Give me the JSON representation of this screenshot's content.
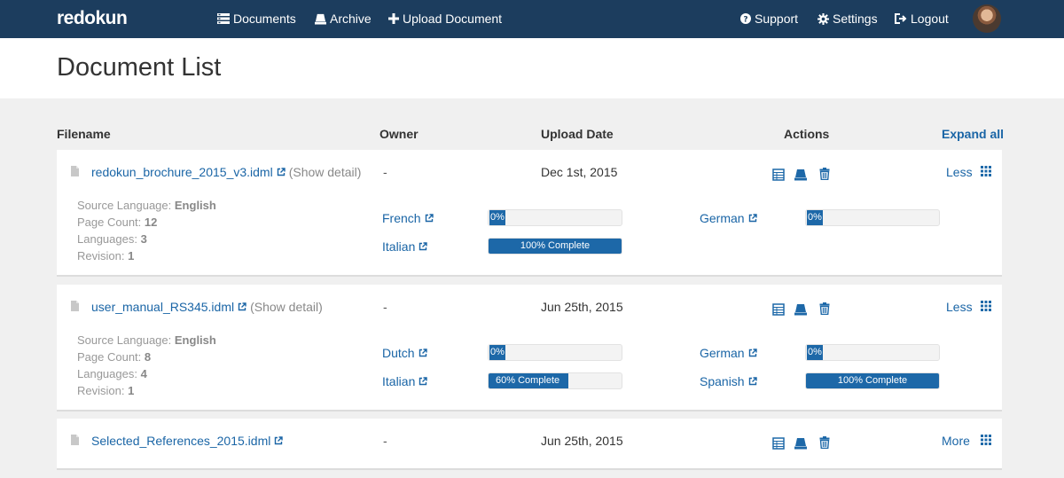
{
  "navbar": {
    "brand": "redokun",
    "documents": "Documents",
    "archive": "Archive",
    "upload": "Upload Document",
    "support": "Support",
    "settings": "Settings",
    "logout": "Logout"
  },
  "page": {
    "title": "Document List"
  },
  "table": {
    "headers": {
      "filename": "Filename",
      "owner": "Owner",
      "upload_date": "Upload Date",
      "actions": "Actions"
    },
    "expand_all": "Expand all"
  },
  "documents": [
    {
      "filename": "redokun_brochure_2015_v3.idml",
      "show_detail": "(Show detail)",
      "owner": "-",
      "upload_date": "Dec 1st, 2015",
      "toggle": "Less",
      "meta": {
        "source_language_label": "Source Language:",
        "source_language": "English",
        "page_count_label": "Page Count:",
        "page_count": "12",
        "languages_label": "Languages:",
        "languages": "3",
        "revision_label": "Revision:",
        "revision": "1"
      },
      "translations": [
        {
          "language": "French",
          "progress": 0,
          "label": "0%"
        },
        {
          "language": "German",
          "progress": 0,
          "label": "0%"
        },
        {
          "language": "Italian",
          "progress": 100,
          "label": "100% Complete"
        }
      ]
    },
    {
      "filename": "user_manual_RS345.idml",
      "show_detail": "(Show detail)",
      "owner": "-",
      "upload_date": "Jun 25th, 2015",
      "toggle": "Less",
      "meta": {
        "source_language_label": "Source Language:",
        "source_language": "English",
        "page_count_label": "Page Count:",
        "page_count": "8",
        "languages_label": "Languages:",
        "languages": "4",
        "revision_label": "Revision:",
        "revision": "1"
      },
      "translations": [
        {
          "language": "Dutch",
          "progress": 0,
          "label": "0%"
        },
        {
          "language": "German",
          "progress": 0,
          "label": "0%"
        },
        {
          "language": "Italian",
          "progress": 60,
          "label": "60% Complete"
        },
        {
          "language": "Spanish",
          "progress": 100,
          "label": "100% Complete"
        }
      ]
    },
    {
      "filename": "Selected_References_2015.idml",
      "owner": "-",
      "upload_date": "Jun 25th, 2015",
      "toggle": "More"
    }
  ],
  "icons": {
    "documents": "list-icon",
    "archive": "archive-icon",
    "upload": "plus-icon",
    "support": "question-circle-icon",
    "settings": "gear-icon",
    "logout": "logout-icon",
    "file": "file-icon",
    "external": "external-link-icon",
    "view": "table-icon",
    "archive_action": "archive-icon",
    "delete": "trash-icon",
    "grid": "grid-icon"
  },
  "colors": {
    "navbar": "#1c3d5e",
    "link": "#1a65a6",
    "progress": "#1d68a8"
  }
}
